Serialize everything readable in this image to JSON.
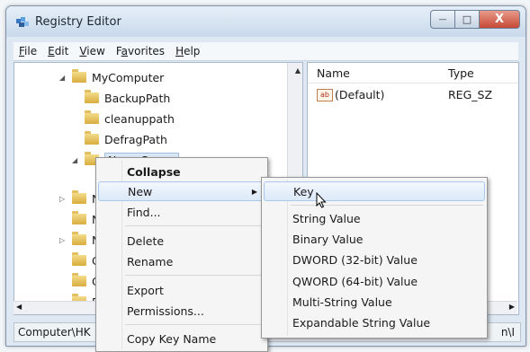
{
  "window": {
    "title": "Registry Editor",
    "controls": {
      "minimize": "—",
      "maximize": "□",
      "close": "X"
    }
  },
  "menubar": {
    "items": [
      {
        "label": "File",
        "hotkey": "F",
        "rest": "ile"
      },
      {
        "label": "Edit",
        "hotkey": "E",
        "rest": "dit"
      },
      {
        "label": "View",
        "hotkey": "V",
        "rest": "iew"
      },
      {
        "label": "Favorites",
        "pre": "F",
        "hotkey": "a",
        "rest": "vorites"
      },
      {
        "label": "Help",
        "hotkey": "H",
        "rest": "elp"
      }
    ]
  },
  "tree": {
    "nodes": [
      {
        "label": "MyComputer",
        "expanded": true
      },
      {
        "label": "BackupPath"
      },
      {
        "label": "cleanuppath"
      },
      {
        "label": "DefragPath"
      },
      {
        "label": "NameSpace",
        "expanded": true,
        "selected": true
      },
      {
        "label": "N"
      },
      {
        "label": "N"
      },
      {
        "label": "N"
      },
      {
        "label": "C"
      },
      {
        "label": "C"
      },
      {
        "label": "P"
      }
    ]
  },
  "details": {
    "columns": {
      "name": "Name",
      "type": "Type"
    },
    "rows": [
      {
        "name": "(Default)",
        "type": "REG_SZ"
      }
    ]
  },
  "status": {
    "path": "Computer\\HK",
    "tail": "n\\I"
  },
  "context_menu": {
    "collapse": "Collapse",
    "new": "New",
    "find": "Find...",
    "delete": "Delete",
    "rename": "Rename",
    "export": "Export",
    "permissions": "Permissions...",
    "copy_key_name": "Copy Key Name"
  },
  "submenu": {
    "key": "Key",
    "string_value": "String Value",
    "binary_value": "Binary Value",
    "dword": "DWORD (32-bit) Value",
    "qword": "QWORD (64-bit) Value",
    "multi_string": "Multi-String Value",
    "expandable_string": "Expandable String Value"
  }
}
